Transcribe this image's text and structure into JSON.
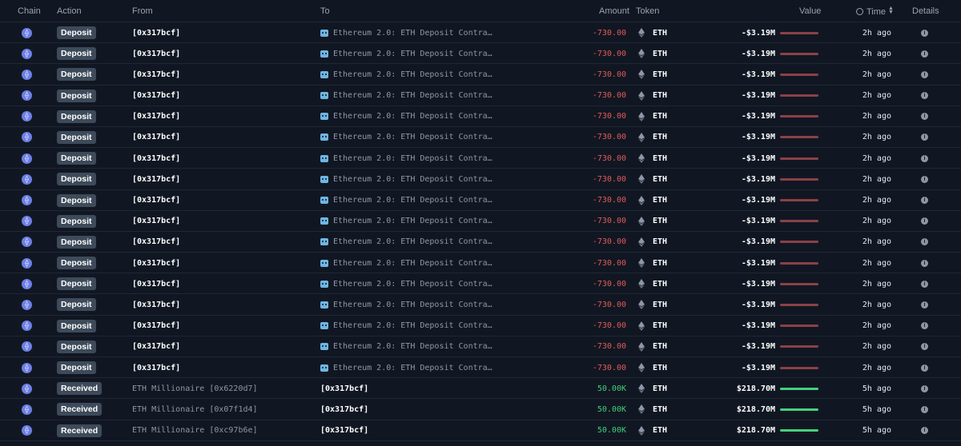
{
  "header": {
    "chain": "Chain",
    "action": "Action",
    "from": "From",
    "to": "To",
    "amount": "Amount",
    "token": "Token",
    "value": "Value",
    "time": "Time",
    "details": "Details"
  },
  "icons": {
    "chain": "ethereum-chain-icon",
    "token": "eth-diamond-icon",
    "to_entity": "robot-icon",
    "details": "info-icon",
    "time_header": "clock-icon",
    "sort": "sort-icon"
  },
  "colors": {
    "negative": "#e05a5a",
    "positive": "#3fcf7a",
    "badge": "#3d4a5a"
  },
  "rows": [
    {
      "action": "Deposit",
      "from": "[0x317bcf]",
      "to": "Ethereum 2.0: ETH Deposit Contra…",
      "to_icon": true,
      "amount": "-730.00",
      "sign": "neg",
      "token": "ETH",
      "value": "-$3.19M",
      "time": "2h ago"
    },
    {
      "action": "Deposit",
      "from": "[0x317bcf]",
      "to": "Ethereum 2.0: ETH Deposit Contra…",
      "to_icon": true,
      "amount": "-730.00",
      "sign": "neg",
      "token": "ETH",
      "value": "-$3.19M",
      "time": "2h ago"
    },
    {
      "action": "Deposit",
      "from": "[0x317bcf]",
      "to": "Ethereum 2.0: ETH Deposit Contra…",
      "to_icon": true,
      "amount": "-730.00",
      "sign": "neg",
      "token": "ETH",
      "value": "-$3.19M",
      "time": "2h ago"
    },
    {
      "action": "Deposit",
      "from": "[0x317bcf]",
      "to": "Ethereum 2.0: ETH Deposit Contra…",
      "to_icon": true,
      "amount": "-730.00",
      "sign": "neg",
      "token": "ETH",
      "value": "-$3.19M",
      "time": "2h ago"
    },
    {
      "action": "Deposit",
      "from": "[0x317bcf]",
      "to": "Ethereum 2.0: ETH Deposit Contra…",
      "to_icon": true,
      "amount": "-730.00",
      "sign": "neg",
      "token": "ETH",
      "value": "-$3.19M",
      "time": "2h ago"
    },
    {
      "action": "Deposit",
      "from": "[0x317bcf]",
      "to": "Ethereum 2.0: ETH Deposit Contra…",
      "to_icon": true,
      "amount": "-730.00",
      "sign": "neg",
      "token": "ETH",
      "value": "-$3.19M",
      "time": "2h ago"
    },
    {
      "action": "Deposit",
      "from": "[0x317bcf]",
      "to": "Ethereum 2.0: ETH Deposit Contra…",
      "to_icon": true,
      "amount": "-730.00",
      "sign": "neg",
      "token": "ETH",
      "value": "-$3.19M",
      "time": "2h ago"
    },
    {
      "action": "Deposit",
      "from": "[0x317bcf]",
      "to": "Ethereum 2.0: ETH Deposit Contra…",
      "to_icon": true,
      "amount": "-730.00",
      "sign": "neg",
      "token": "ETH",
      "value": "-$3.19M",
      "time": "2h ago"
    },
    {
      "action": "Deposit",
      "from": "[0x317bcf]",
      "to": "Ethereum 2.0: ETH Deposit Contra…",
      "to_icon": true,
      "amount": "-730.00",
      "sign": "neg",
      "token": "ETH",
      "value": "-$3.19M",
      "time": "2h ago"
    },
    {
      "action": "Deposit",
      "from": "[0x317bcf]",
      "to": "Ethereum 2.0: ETH Deposit Contra…",
      "to_icon": true,
      "amount": "-730.00",
      "sign": "neg",
      "token": "ETH",
      "value": "-$3.19M",
      "time": "2h ago"
    },
    {
      "action": "Deposit",
      "from": "[0x317bcf]",
      "to": "Ethereum 2.0: ETH Deposit Contra…",
      "to_icon": true,
      "amount": "-730.00",
      "sign": "neg",
      "token": "ETH",
      "value": "-$3.19M",
      "time": "2h ago"
    },
    {
      "action": "Deposit",
      "from": "[0x317bcf]",
      "to": "Ethereum 2.0: ETH Deposit Contra…",
      "to_icon": true,
      "amount": "-730.00",
      "sign": "neg",
      "token": "ETH",
      "value": "-$3.19M",
      "time": "2h ago"
    },
    {
      "action": "Deposit",
      "from": "[0x317bcf]",
      "to": "Ethereum 2.0: ETH Deposit Contra…",
      "to_icon": true,
      "amount": "-730.00",
      "sign": "neg",
      "token": "ETH",
      "value": "-$3.19M",
      "time": "2h ago"
    },
    {
      "action": "Deposit",
      "from": "[0x317bcf]",
      "to": "Ethereum 2.0: ETH Deposit Contra…",
      "to_icon": true,
      "amount": "-730.00",
      "sign": "neg",
      "token": "ETH",
      "value": "-$3.19M",
      "time": "2h ago"
    },
    {
      "action": "Deposit",
      "from": "[0x317bcf]",
      "to": "Ethereum 2.0: ETH Deposit Contra…",
      "to_icon": true,
      "amount": "-730.00",
      "sign": "neg",
      "token": "ETH",
      "value": "-$3.19M",
      "time": "2h ago"
    },
    {
      "action": "Deposit",
      "from": "[0x317bcf]",
      "to": "Ethereum 2.0: ETH Deposit Contra…",
      "to_icon": true,
      "amount": "-730.00",
      "sign": "neg",
      "token": "ETH",
      "value": "-$3.19M",
      "time": "2h ago"
    },
    {
      "action": "Deposit",
      "from": "[0x317bcf]",
      "to": "Ethereum 2.0: ETH Deposit Contra…",
      "to_icon": true,
      "amount": "-730.00",
      "sign": "neg",
      "token": "ETH",
      "value": "-$3.19M",
      "time": "2h ago"
    },
    {
      "action": "Received",
      "from": "ETH Millionaire [0x6220d7]",
      "to": "[0x317bcf]",
      "to_icon": false,
      "amount": "50.00K",
      "sign": "pos",
      "token": "ETH",
      "value": "$218.70M",
      "time": "5h ago"
    },
    {
      "action": "Received",
      "from": "ETH Millionaire [0x07f1d4]",
      "to": "[0x317bcf]",
      "to_icon": false,
      "amount": "50.00K",
      "sign": "pos",
      "token": "ETH",
      "value": "$218.70M",
      "time": "5h ago"
    },
    {
      "action": "Received",
      "from": "ETH Millionaire [0xc97b6e]",
      "to": "[0x317bcf]",
      "to_icon": false,
      "amount": "50.00K",
      "sign": "pos",
      "token": "ETH",
      "value": "$218.70M",
      "time": "5h ago"
    }
  ]
}
